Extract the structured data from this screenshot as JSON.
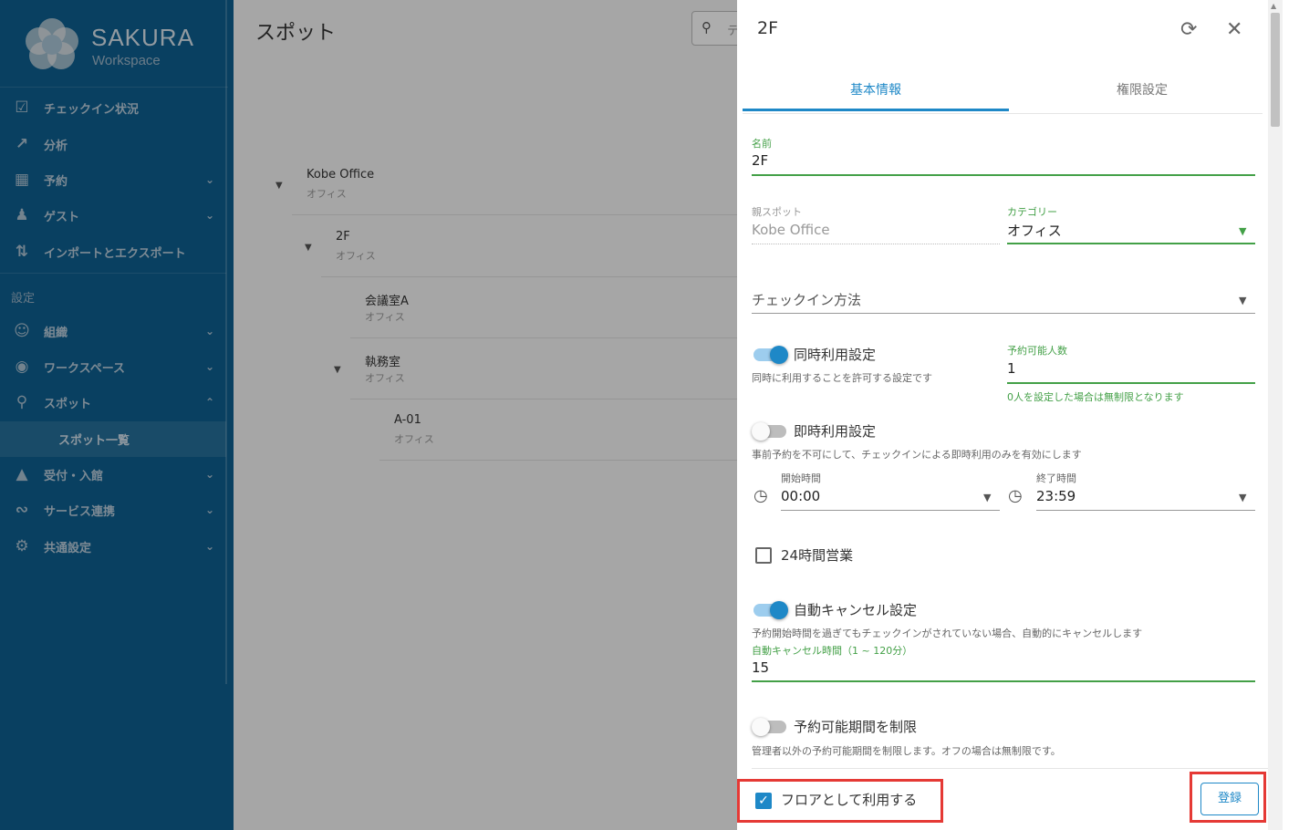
{
  "sidebar": {
    "brand": "SAKURA",
    "brand_sub": "Workspace",
    "items": [
      {
        "label": "チェックイン状況",
        "icon": "check-square-icon"
      },
      {
        "label": "分析",
        "icon": "chart-line-icon"
      },
      {
        "label": "予約",
        "icon": "calendar-clock-icon"
      },
      {
        "label": "ゲスト",
        "icon": "guest-icon"
      },
      {
        "label": "インポートとエクスポート",
        "icon": "import-export-icon"
      }
    ],
    "section_label": "設定",
    "settings_items": [
      {
        "label": "組織",
        "icon": "people-icon"
      },
      {
        "label": "ワークスペース",
        "icon": "map-pin-icon"
      },
      {
        "label": "スポット",
        "icon": "spot-person-icon"
      },
      {
        "label": "スポット一覧",
        "icon": ""
      },
      {
        "label": "受付・入館",
        "icon": "reception-bell-icon"
      },
      {
        "label": "サービス連携",
        "icon": "integration-icon"
      },
      {
        "label": "共通設定",
        "icon": "gears-icon"
      }
    ]
  },
  "main": {
    "title": "スポット",
    "search_placeholder": "テ",
    "tree": [
      {
        "name": "Kobe Office",
        "type": "オフィス"
      },
      {
        "name": "2F",
        "type": "オフィス"
      },
      {
        "name": "会議室A",
        "type": "オフィス"
      },
      {
        "name": "執務室",
        "type": "オフィス"
      },
      {
        "name": "A-01",
        "type": "オフィス"
      }
    ]
  },
  "panel": {
    "title": "2F",
    "tabs": [
      {
        "label": "基本情報",
        "active": true
      },
      {
        "label": "権限設定",
        "active": false
      }
    ],
    "name_label": "名前",
    "name_value": "2F",
    "parent_label": "親スポット",
    "parent_value": "Kobe Office",
    "category_label": "カテゴリー",
    "category_value": "オフィス",
    "checkin_placeholder": "チェックイン方法",
    "concurrent": {
      "label": "同時利用設定",
      "desc": "同時に利用することを許可する設定です",
      "enabled": true
    },
    "capacity_label": "予約可能人数",
    "capacity_value": "1",
    "capacity_hint": "0人を設定した場合は無制限となります",
    "instant": {
      "label": "即時利用設定",
      "desc": "事前予約を不可にして、チェックインによる即時利用のみを有効にします",
      "enabled": false
    },
    "start_label": "開始時間",
    "start_value": "00:00",
    "end_label": "終了時間",
    "end_value": "23:59",
    "allday_label": "24時間営業",
    "allday_checked": false,
    "autocancel": {
      "label": "自動キャンセル設定",
      "desc": "予約開始時間を過ぎてもチェックインがされていない場合、自動的にキャンセルします",
      "enabled": true
    },
    "autocancel_time_label": "自動キャンセル時間（1 ~ 120分）",
    "autocancel_time_value": "15",
    "limit": {
      "label": "予約可能期間を制限",
      "desc": "管理者以外の予約可能期間を制限します。オフの場合は無制限です。",
      "enabled": false
    },
    "floor_label": "フロアとして利用する",
    "floor_checked": true,
    "register_label": "登録"
  },
  "colors": {
    "sidebar_bg": "#0e5f8f",
    "accent": "#1e88c7",
    "valid_green": "#43a047",
    "highlight_red": "#e53935"
  }
}
